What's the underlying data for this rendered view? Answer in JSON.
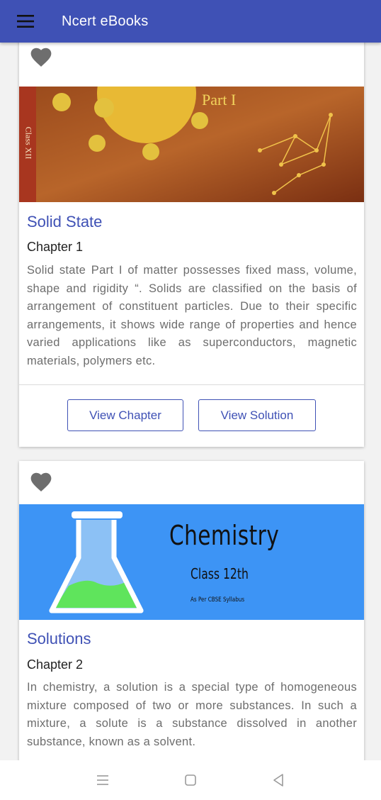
{
  "app": {
    "title": "Ncert eBooks",
    "accent": "#3f51b5"
  },
  "icons": {
    "menu": "hamburger-icon",
    "favorite": "heart-icon",
    "nav_recents": "recents-icon",
    "nav_home": "home-icon",
    "nav_back": "back-icon"
  },
  "chapters": [
    {
      "title": "Solid State",
      "chapter": "Chapter 1",
      "description": "Solid state Part I of matter possesses fixed mass, volume, shape and rigidity “. Solids are classified on the basis of arrangement of constituent particles. Due to their specific arrangements, it shows wide range of properties and hence varied applications like as superconductors, magnetic materials, polymers etc.",
      "banner": {
        "part_text": "Part I",
        "side_text": "Class XII"
      },
      "view_chapter_label": "View Chapter",
      "view_solution_label": "View Solution"
    },
    {
      "title": "Solutions",
      "chapter": "Chapter 2",
      "description": "In chemistry, a solution is a special type of homogeneous mixture composed of two or more substances. In such a mixture, a solute is a substance dissolved in another substance, known as a solvent.",
      "banner": {
        "subject": "Chemistry",
        "class_text": "Class 12th",
        "syllabus_text": "As Per CBSE Syllabus"
      }
    }
  ]
}
